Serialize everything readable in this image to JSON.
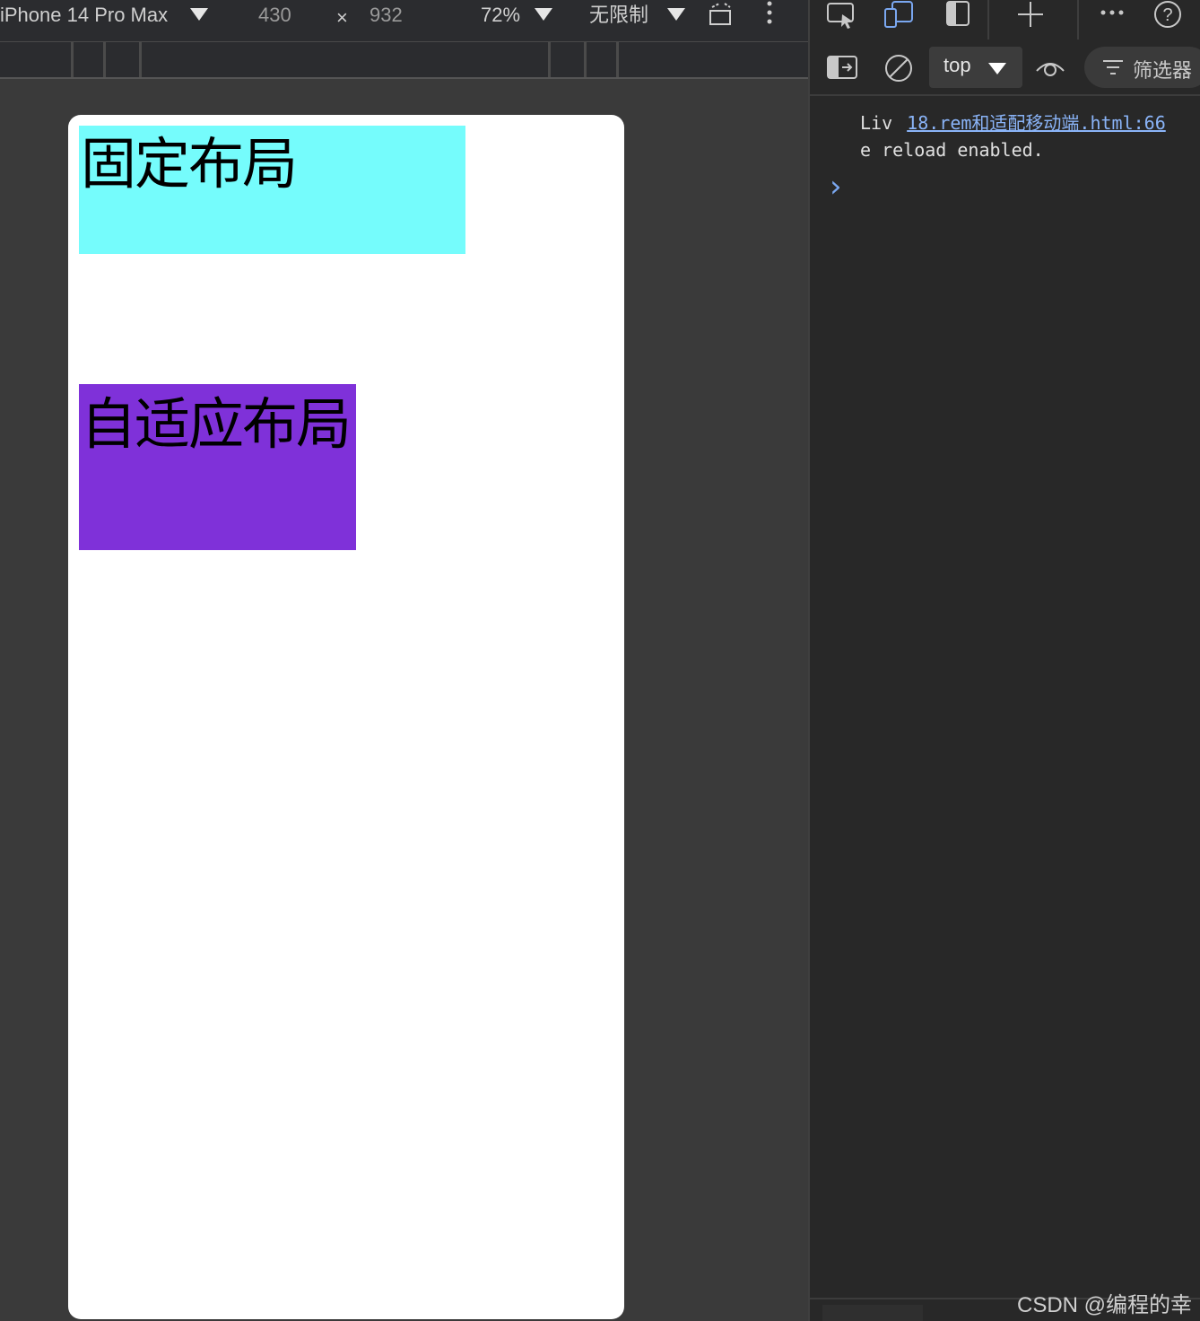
{
  "device_toolbar": {
    "device": "iPhone 14 Pro Max",
    "width": "430",
    "times": "×",
    "height": "932",
    "zoom": "72%",
    "throttle": "无限制"
  },
  "page": {
    "box1_text": "固定布局",
    "box2_text": "自适应布局",
    "box1_color": "#75fcfc",
    "box2_color": "#7f31d9"
  },
  "devtools": {
    "context": "top",
    "filter_label": "筛选器",
    "log_prefix": "Liv",
    "log_link": "18.rem和适配移动端.html:66",
    "log_line2": "e reload enabled.",
    "prompt": "›"
  },
  "watermark": "CSDN @编程的幸"
}
